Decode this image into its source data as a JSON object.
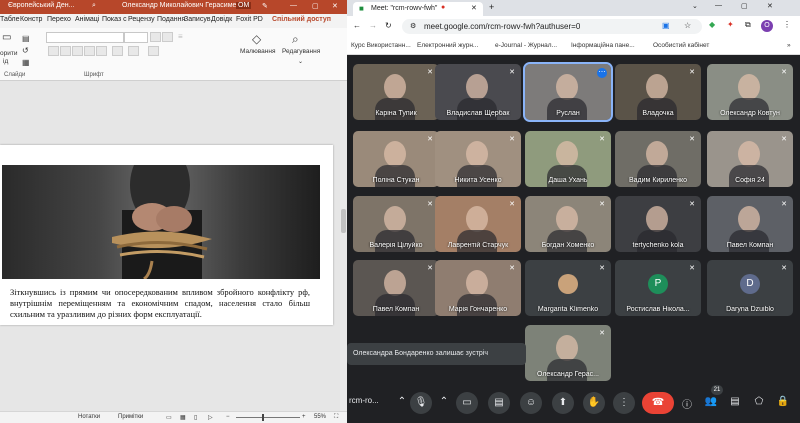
{
  "ppt": {
    "title_left": "Європейський Ден...",
    "title_user": "Олександр Миколайович Герасименко",
    "user_initials": "ОМ",
    "tabs": [
      "Табле",
      "Констр",
      "Перехо",
      "Анімаці",
      "Показ с",
      "Рецензу",
      "Подання",
      "Записув",
      "Довідк",
      "Foxit PD",
      "Спільний доступ"
    ],
    "ribbon": {
      "group_slides": "Слайди",
      "group_font": "Шрифт",
      "btn_create_frag": "орити",
      "btn_create_frag2": "ід",
      "btn_drawing": "Малювання",
      "btn_editing": "Редагування"
    },
    "slide_text": "Зіткнувшись із прямим чи опосередкованим впливом збройного конфлікту рф, внутрішнім переміщенням та економічним спадом, населення стало більш схильним та уразливим до різних форм експлуатації.",
    "status": {
      "notes": "Нотатки",
      "comments": "Примітки",
      "zoom": "55%"
    }
  },
  "chrome": {
    "tab_title": "Meet: \"rcm-rowv-fwh\"",
    "url": "meet.google.com/rcm-rowv-fwh?authuser=0",
    "profile_initial": "O",
    "bookmarks": [
      "Курс Використанн...",
      "Електронний журн...",
      "e-Journal - Журнал...",
      "Інформаційна пане...",
      "Особистий кабінет"
    ]
  },
  "meet": {
    "tiles": [
      {
        "name": "Каріна Тупик",
        "type": "video",
        "bg": "#6b6255"
      },
      {
        "name": "Владислав Щербак",
        "type": "video",
        "bg": "#4a4a4f"
      },
      {
        "name": "Руслан",
        "type": "video",
        "bg": "#7d7b7a",
        "speaking": true
      },
      {
        "name": "Владочка",
        "type": "video",
        "bg": "#5a5348"
      },
      {
        "name": "Олександр Ковтун",
        "type": "video",
        "bg": "#8a8e85"
      },
      {
        "name": "Поліна Стукан",
        "type": "video",
        "bg": "#9a8a7a"
      },
      {
        "name": "Никита Усенко",
        "type": "video",
        "bg": "#a09080"
      },
      {
        "name": "Даша Ухань",
        "type": "video",
        "bg": "#8f9b7d"
      },
      {
        "name": "Вадим Кириленко",
        "type": "video",
        "bg": "#6f6d66"
      },
      {
        "name": "Софія 24",
        "type": "video",
        "bg": "#9a948c"
      },
      {
        "name": "Валерія Цілуйко",
        "type": "video",
        "bg": "#7e7468"
      },
      {
        "name": "Лаврентій Старчук",
        "type": "video",
        "bg": "#a47f66"
      },
      {
        "name": "Богдан Хоменко",
        "type": "video",
        "bg": "#8c8579"
      },
      {
        "name": "tertychenko kola",
        "type": "video",
        "bg": "#3d3e42"
      },
      {
        "name": "Павел Компан",
        "type": "video",
        "bg": "#5d6066"
      },
      {
        "name": "Павел Компан",
        "type": "video",
        "bg": "#5b5652"
      },
      {
        "name": "Марія Гончаренко",
        "type": "video",
        "bg": "#8f7d70"
      },
      {
        "name": "Margarita Klimenko",
        "type": "avatar",
        "bg": "#3c4043",
        "avatar_bg": "#c9a27a",
        "initial": ""
      },
      {
        "name": "Ростислав Нікола...",
        "type": "avatar",
        "bg": "#3c4043",
        "avatar_bg": "#1e8e5a",
        "initial": "Р"
      },
      {
        "name": "Daryna Dzuiblo",
        "type": "avatar",
        "bg": "#3c4043",
        "avatar_bg": "#5f6b8c",
        "initial": "D"
      },
      {
        "name": "Олександр Герас...",
        "type": "video",
        "bg": "#7d8278"
      }
    ],
    "toast": "Олександра Бондаренко залишає зустріч",
    "meeting_code": "rcm-ro...",
    "participants_count": "21"
  }
}
